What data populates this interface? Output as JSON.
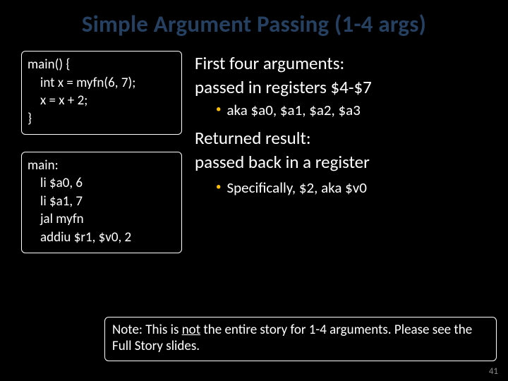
{
  "title": "Simple Argument Passing (1-4 args)",
  "code1": {
    "l1": "main() {",
    "l2": "int x = myfn(6, 7);",
    "l3": "x = x + 2;",
    "l4": "}"
  },
  "code2": {
    "l1": "main:",
    "l2": "li $a0, 6",
    "l3": "li $a1, 7",
    "l4": "jal myfn",
    "l5": "addiu $r1, $v0, 2"
  },
  "body": {
    "p1a": "First four arguments:",
    "p1b": "passed in registers $4-$7",
    "b1": "aka $a0, $a1, $a2, $a3",
    "p2a": "Returned result:",
    "p2b": "passed back in a register",
    "b2": "Specifically, $2, aka $v0"
  },
  "note": {
    "prefix": "Note: This is ",
    "not": "not",
    "rest": " the entire story for 1-4 arguments. Please see the Full Story slides."
  },
  "page": "41"
}
